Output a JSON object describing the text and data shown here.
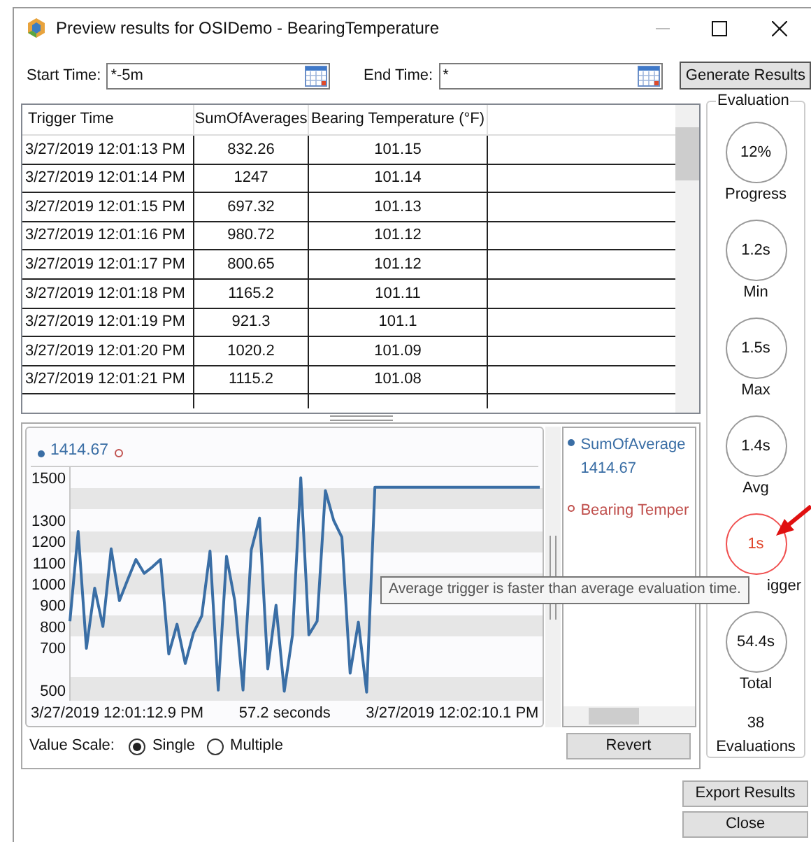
{
  "window": {
    "title": "Preview results for OSIDemo - BearingTemperature"
  },
  "start_time": {
    "label": "Start Time:",
    "value": "*-5m"
  },
  "end_time": {
    "label": "End Time:",
    "value": "*"
  },
  "generate_button": "Generate Results",
  "table": {
    "columns": [
      "Trigger Time",
      "SumOfAverages",
      "Bearing Temperature (°F)"
    ],
    "rows": [
      [
        "3/27/2019 12:01:13 PM",
        "832.26",
        "101.15"
      ],
      [
        "3/27/2019 12:01:14 PM",
        "1247",
        "101.14"
      ],
      [
        "3/27/2019 12:01:15 PM",
        "697.32",
        "101.13"
      ],
      [
        "3/27/2019 12:01:16 PM",
        "980.72",
        "101.12"
      ],
      [
        "3/27/2019 12:01:17 PM",
        "800.65",
        "101.12"
      ],
      [
        "3/27/2019 12:01:18 PM",
        "1165.2",
        "101.11"
      ],
      [
        "3/27/2019 12:01:19 PM",
        "921.3",
        "101.1"
      ],
      [
        "3/27/2019 12:01:20 PM",
        "1020.2",
        "101.09"
      ],
      [
        "3/27/2019 12:01:21 PM",
        "1115.2",
        "101.08"
      ]
    ]
  },
  "chart": {
    "cursor_value": "1414.67",
    "x_start_label": "3/27/2019 12:01:12.9 PM",
    "x_span_label": "57.2 seconds",
    "x_end_label": "3/27/2019 12:02:10.1 PM",
    "chart_data": {
      "type": "line",
      "categories": [
        null,
        null,
        null,
        null,
        null,
        null,
        null,
        null,
        null,
        null,
        null,
        null,
        null,
        null,
        null,
        null,
        null,
        null,
        null,
        null,
        null,
        null,
        null,
        null,
        null,
        null,
        null,
        null,
        null,
        null,
        null,
        null,
        null,
        null,
        null,
        null,
        null,
        null,
        null,
        null,
        null,
        null,
        null,
        null,
        null,
        null,
        null,
        null,
        null,
        null,
        null,
        null,
        null,
        null,
        null,
        null,
        null,
        null
      ],
      "ylim": [
        450,
        1550
      ],
      "yticks": [
        500,
        700,
        800,
        900,
        1000,
        1100,
        1200,
        1300,
        1500
      ],
      "series": [
        {
          "name": "SumOfAverage",
          "color": "#3a6ea5",
          "values": [
            825,
            1247,
            697,
            980,
            800,
            1165,
            921,
            1020,
            1115,
            1050,
            1080,
            1115,
            670,
            810,
            625,
            770,
            850,
            1155,
            500,
            1130,
            920,
            500,
            1160,
            1310,
            600,
            900,
            495,
            760,
            1500,
            760,
            825,
            1440,
            1300,
            1220,
            580,
            820,
            490,
            1455,
            1455,
            1455,
            1455,
            1455,
            1455,
            1455,
            1455,
            1455,
            1455,
            1455,
            1455,
            1455,
            1455,
            1455,
            1455,
            1455,
            1455,
            1455,
            1455,
            1455
          ]
        }
      ]
    }
  },
  "legend": [
    {
      "value": "1414.67",
      "filled": true
    },
    {
      "name": "Bearing Temper",
      "color": "#c0504d",
      "filled": false
    }
  ],
  "value_scale": {
    "label": "Value Scale:",
    "options": [
      {
        "label": "Single",
        "selected": true
      },
      {
        "label": "Multiple",
        "selected": false
      }
    ]
  },
  "revert_button": "Revert",
  "evaluation": {
    "title": "Evaluation",
    "stats": [
      {
        "value": "12%",
        "label": "Progress",
        "alert": false
      },
      {
        "value": "1.2s",
        "label": "Min",
        "alert": false
      },
      {
        "value": "1.5s",
        "label": "Max",
        "alert": false
      },
      {
        "value": "1.4s",
        "label": "Avg",
        "alert": false
      },
      {
        "value": "1s",
        "label": "igger",
        "alert": true
      },
      {
        "value": "54.4s",
        "label": "Total",
        "alert": false
      }
    ],
    "count": "38",
    "count_label": "Evaluations"
  },
  "tooltip": "Average trigger is faster than average evaluation time.",
  "buttons": [
    "Export Results",
    "Close"
  ]
}
